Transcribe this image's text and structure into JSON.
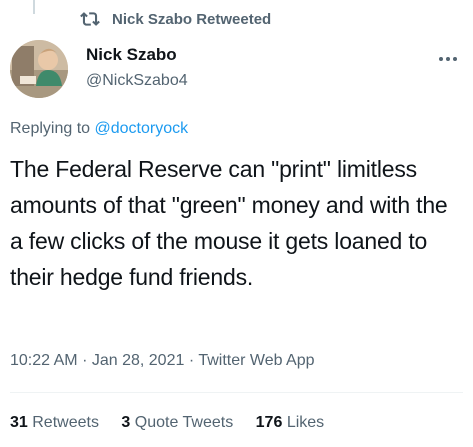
{
  "retweet_bar": {
    "icon": "retweet-icon",
    "label": "Nick Szabo Retweeted"
  },
  "author": {
    "name": "Nick Szabo",
    "handle": "@NickSzabo4"
  },
  "more_icon": "more-horizontal-icon",
  "reply": {
    "prefix": "Replying to",
    "target": "@doctoryock"
  },
  "tweet": {
    "text": "The Federal Reserve can \"print\" limitless amounts of that \"green\" money and with the a few clicks of the mouse it gets loaned to their hedge fund friends."
  },
  "meta": {
    "time": "10:22 AM",
    "date": "Jan 28, 2021",
    "source": "Twitter Web App",
    "separator": "·"
  },
  "stats": {
    "retweets_count": "31",
    "retweets_label": "Retweets",
    "quote_count": "3",
    "quote_label": "Quote Tweets",
    "likes_count": "176",
    "likes_label": "Likes"
  },
  "colors": {
    "secondary_text": "#536471",
    "link": "#1d9bf0",
    "primary_text": "#0f1419"
  }
}
